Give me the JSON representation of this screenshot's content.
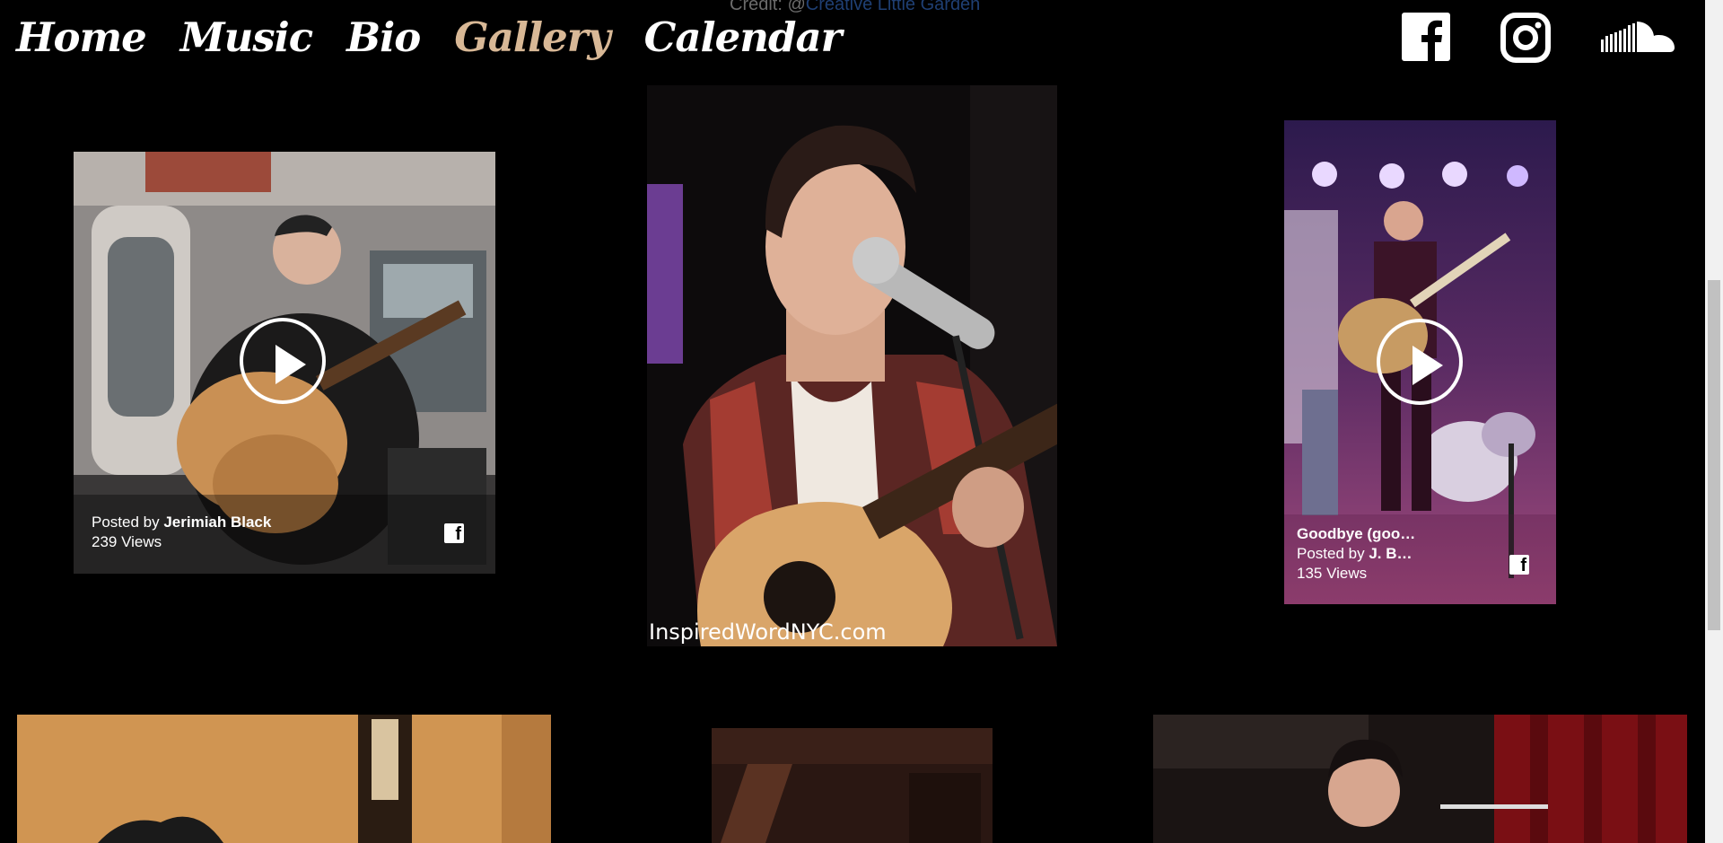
{
  "credit": {
    "prefix": "Credit: @",
    "link": "Creative Little Garden"
  },
  "nav": {
    "items": [
      {
        "label": "Home"
      },
      {
        "label": "Music"
      },
      {
        "label": "Bio"
      },
      {
        "label": "Gallery",
        "active": true
      },
      {
        "label": "Calendar"
      }
    ]
  },
  "social": {
    "icons": [
      "facebook-icon",
      "instagram-icon",
      "soundcloud-icon"
    ]
  },
  "gallery": {
    "card1": {
      "posted_prefix": "Posted by ",
      "author": "Jerimiah Black",
      "views": "239 Views"
    },
    "card2": {
      "watermark": "InspiredWordNYC.com"
    },
    "card3": {
      "title": "Goodbye (goo…",
      "posted_prefix": "Posted by ",
      "author": "J. B…",
      "views": "135 Views"
    }
  },
  "colors": {
    "active_nav": "#d8b896",
    "background": "#000000"
  }
}
